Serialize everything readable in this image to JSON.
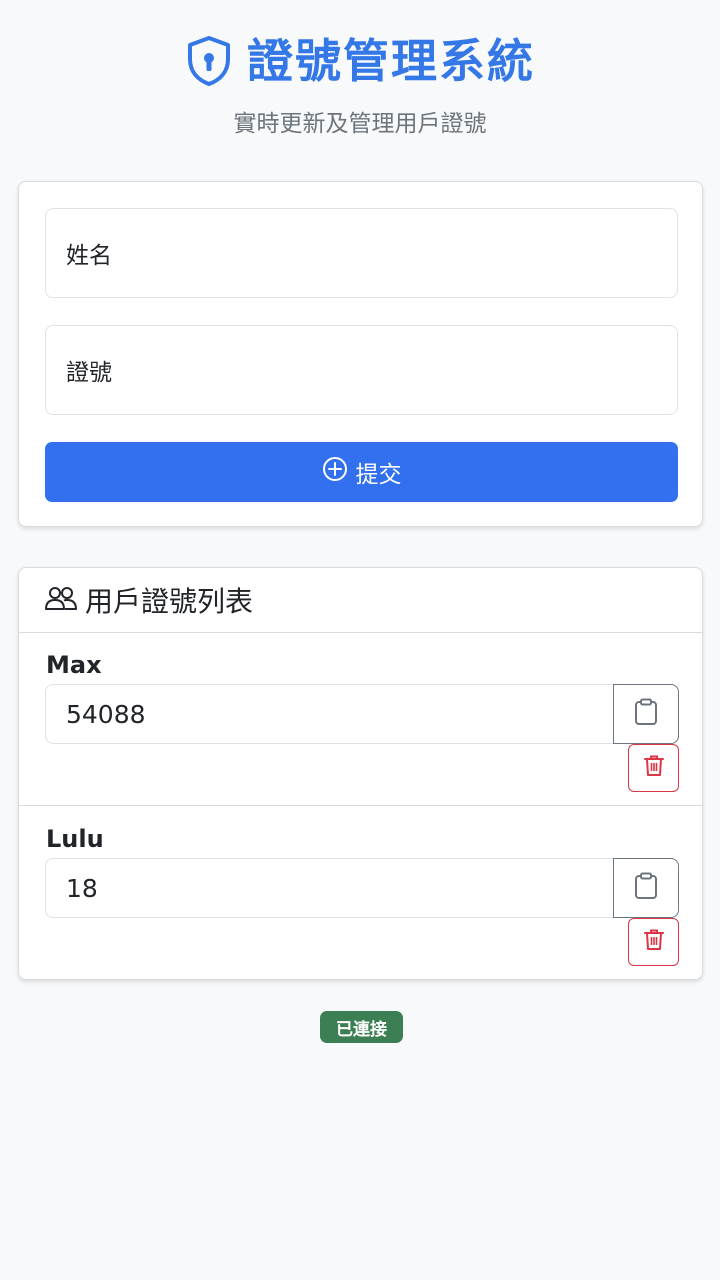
{
  "header": {
    "icon": "shield-lock-icon",
    "title": "證號管理系統",
    "subtitle": "實時更新及管理用戶證號"
  },
  "form": {
    "name_placeholder": "姓名",
    "id_placeholder": "證號",
    "submit_label": "提交",
    "submit_icon": "plus-circle-icon"
  },
  "list": {
    "icon": "people-icon",
    "title": "用戶證號列表",
    "entries": [
      {
        "name": "Max",
        "value": "54088"
      },
      {
        "name": "Lulu",
        "value": "18"
      }
    ]
  },
  "status": {
    "label": "已連接",
    "color": "#3d7f54"
  },
  "colors": {
    "accent": "#3478e8",
    "danger": "#dc3545",
    "background": "#f8f9fa"
  }
}
